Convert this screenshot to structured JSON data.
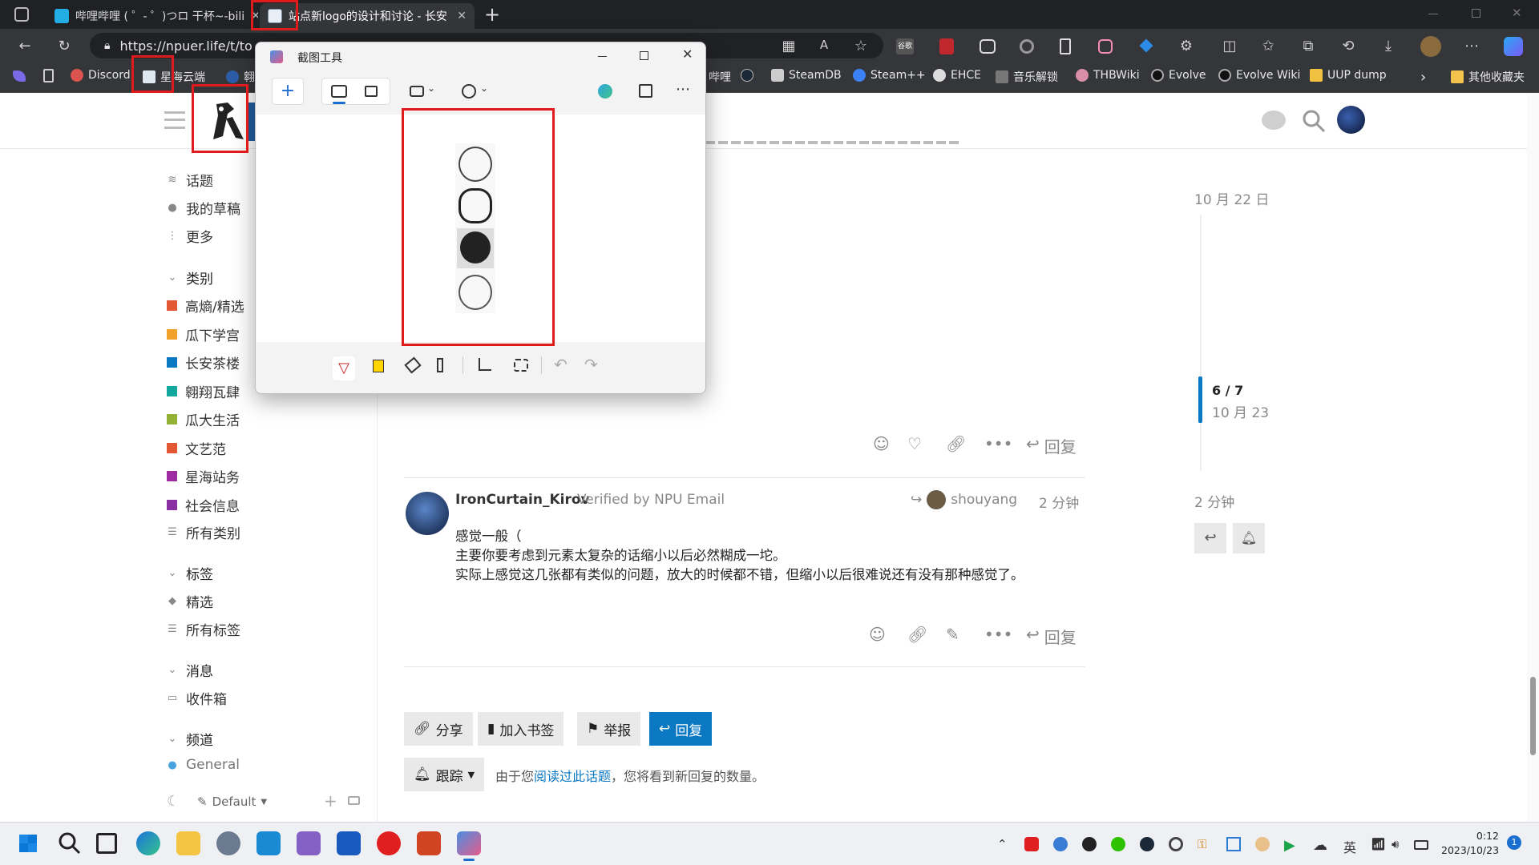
{
  "browser": {
    "tabs": [
      {
        "title": "哔哩哔哩 ( ゜- ゜)つロ 干杯~-bili",
        "active": false
      },
      {
        "title": "站点新logo的设计和讨论 - 长安",
        "active": true
      }
    ],
    "new_tab": "+",
    "url": "https://npuer.life/t/to",
    "bookmarks_left": [
      "Discord",
      "星海云端",
      "翱"
    ],
    "bookmarks_right": [
      "哔哩",
      "SteamDB",
      "Steam++",
      "EHCE",
      "音乐解锁",
      "THBWiki",
      "Evolve",
      "Evolve Wiki",
      "UUP dump"
    ],
    "bookmarks_folder": "其他收藏夹",
    "toolbar_badge": "谷歌"
  },
  "snip": {
    "title": "截图工具",
    "preview_count": 4
  },
  "sidebar": {
    "top": [
      {
        "label": "话题",
        "icon": "layers-icon"
      },
      {
        "label": "我的草稿",
        "icon": "user-icon"
      },
      {
        "label": "更多",
        "icon": "more-vertical-icon"
      }
    ],
    "categories_header": "类别",
    "categories": [
      {
        "label": "高熵/精选",
        "color": "#e45735"
      },
      {
        "label": "瓜下学宫",
        "color": "#f1a22b"
      },
      {
        "label": "长安茶楼",
        "color": "#0a78c3"
      },
      {
        "label": "翱翔瓦肆",
        "color": "#12a89d"
      },
      {
        "label": "瓜大生活",
        "color": "#92b135"
      },
      {
        "label": "文艺范",
        "color": "#e45735"
      },
      {
        "label": "星海站务",
        "color": "#9d2aa0"
      },
      {
        "label": "社会信息",
        "color": "#8a2ea3"
      }
    ],
    "all_categories": "所有类别",
    "tags_header": "标签",
    "tags": [
      "精选",
      "所有标签"
    ],
    "messages_header": "消息",
    "inbox": "收件箱",
    "channels_header": "频道",
    "channel": "General",
    "theme": "Default"
  },
  "timeline": {
    "date_top": "10 月 22 日",
    "progress": "6 / 7",
    "progress_date": "10 月 23",
    "progress_fraction": 0.857,
    "bottom_time": "2 分钟"
  },
  "post": {
    "author": "IronCurtain_Kirov",
    "verified": "Verified by NPU Email",
    "reply_to": "shouyang",
    "time": "2 分钟",
    "lines": [
      "感觉一般（",
      "主要你要考虑到元素太复杂的话缩小以后必然糊成一坨。",
      "实际上感觉这几张都有类似的问题，放大的时候都不错，但缩小以后很难说还有没有那种感觉了。"
    ],
    "reply": "回复"
  },
  "prev_post": {
    "reply": "回复"
  },
  "footer": {
    "share": "分享",
    "bookmark": "加入书签",
    "flag": "举报",
    "reply": "回复",
    "tracking": "跟踪",
    "notice_prefix": "由于您",
    "notice_link": "阅读过此话题",
    "notice_suffix": "，您将看到新回复的数量。"
  },
  "taskbar": {
    "tray_lang": "英",
    "time": "0:12",
    "date": "2023/10/23",
    "notifications": "1"
  }
}
